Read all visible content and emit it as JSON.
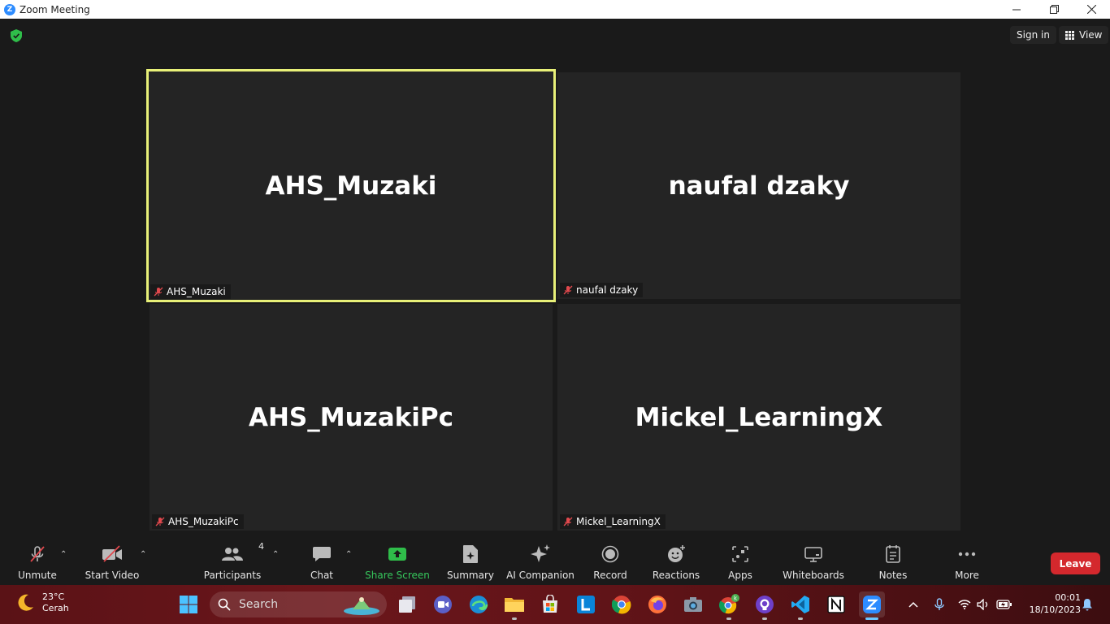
{
  "window": {
    "title": "Zoom Meeting"
  },
  "topbar": {
    "sign_in": "Sign in",
    "view": "View"
  },
  "tiles": [
    {
      "display_name": "AHS_Muzaki",
      "label": "AHS_Muzaki",
      "active": true
    },
    {
      "display_name": "naufal dzaky",
      "label": "naufal dzaky",
      "active": false
    },
    {
      "display_name": "AHS_MuzakiPc",
      "label": "AHS_MuzakiPc",
      "active": false
    },
    {
      "display_name": "Mickel_LearningX",
      "label": "Mickel_LearningX",
      "active": false
    }
  ],
  "toolbar": {
    "unmute": "Unmute",
    "start_video": "Start Video",
    "participants": "Participants",
    "participants_count": "4",
    "chat": "Chat",
    "share_screen": "Share Screen",
    "summary": "Summary",
    "ai_companion": "AI Companion",
    "record": "Record",
    "reactions": "Reactions",
    "apps": "Apps",
    "whiteboards": "Whiteboards",
    "notes": "Notes",
    "more": "More",
    "leave": "Leave"
  },
  "colors": {
    "active_speaker": "#e8f078",
    "share_green": "#36c75c",
    "leave_red": "#d4282d",
    "zoom_blue": "#2d8cff"
  },
  "taskbar": {
    "weather_temp": "23°C",
    "weather_desc": "Cerah",
    "search_placeholder": "Search",
    "time": "00:01",
    "date": "18/10/2023",
    "apps": [
      "widgets-icon",
      "start-icon",
      "file-explorer-icon",
      "meet-icon",
      "edge-icon",
      "folder-icon",
      "store-icon",
      "l-app-icon",
      "chrome-icon",
      "firefox-icon",
      "camera-icon",
      "chrome-profile-icon",
      "github-icon",
      "vscode-icon",
      "notion-icon",
      "zoom-icon"
    ]
  }
}
